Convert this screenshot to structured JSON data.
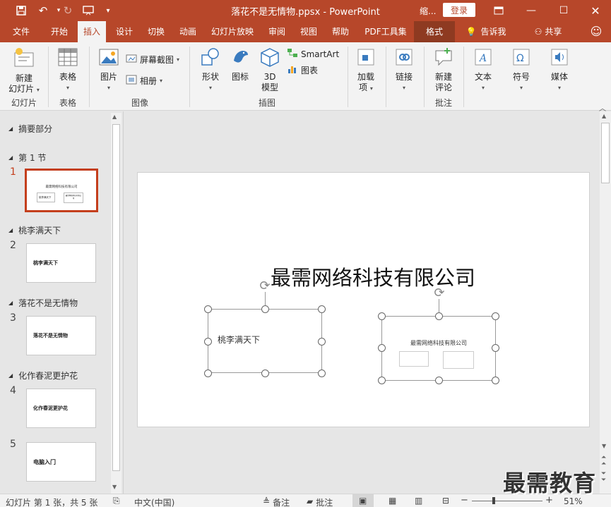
{
  "app": {
    "title": "落花不是无情物.ppsx  -  PowerPoint",
    "title_partial": "缩...",
    "login_label": "登录"
  },
  "menu": {
    "tabs": [
      "文件",
      "开始",
      "插入",
      "设计",
      "切换",
      "动画",
      "幻灯片放映",
      "审阅",
      "视图",
      "帮助",
      "PDF工具集",
      "格式"
    ],
    "active_tab": "插入",
    "tell_me": "告诉我",
    "share": "共享"
  },
  "ribbon": {
    "new_slide": [
      "新建",
      "幻灯片"
    ],
    "table": "表格",
    "image": "图片",
    "screenshot": "屏幕截图",
    "album": "相册",
    "shapes": "形状",
    "icons": "图标",
    "model3d": [
      "3D",
      "模型"
    ],
    "smartart": "SmartArt",
    "chart": "图表",
    "addins": [
      "加载",
      "项"
    ],
    "link": "链接",
    "new_comment": [
      "新建",
      "评论"
    ],
    "text": "文本",
    "symbol": "符号",
    "media": "媒体",
    "groups": {
      "slides": "幻灯片",
      "table": "表格",
      "images": "图像",
      "illustrations": "插图",
      "comments": "批注"
    }
  },
  "slides_pane": {
    "sections": [
      {
        "label": "摘要部分"
      },
      {
        "label": "第 1 节"
      },
      {
        "label": "桃李满天下"
      },
      {
        "label": "落花不是无情物"
      },
      {
        "label": "化作春泥更护花"
      }
    ],
    "slides": [
      {
        "num": "1",
        "title": "最需网络科技有限公司",
        "sub1": "桃李满天下",
        "sub2": "最需网络科技有限公司"
      },
      {
        "num": "2",
        "title": "桃李满天下"
      },
      {
        "num": "3",
        "title": "落花不是无情物"
      },
      {
        "num": "4",
        "title": "化作春泥更护花"
      },
      {
        "num": "5",
        "title": "电脑入门"
      }
    ]
  },
  "slide": {
    "title": "最需网络科技有限公司",
    "box1_text": "桃李满天下",
    "box2_title": "最需网络科技有限公司"
  },
  "status": {
    "slide_info": "幻灯片 第 1 张，共 5 张",
    "language": "中文(中国)",
    "notes": "备注",
    "comments": "批注",
    "zoom": "51%"
  },
  "watermark": "最需教育",
  "colors": {
    "accent": "#b7472a",
    "selection": "#c43e1c"
  }
}
